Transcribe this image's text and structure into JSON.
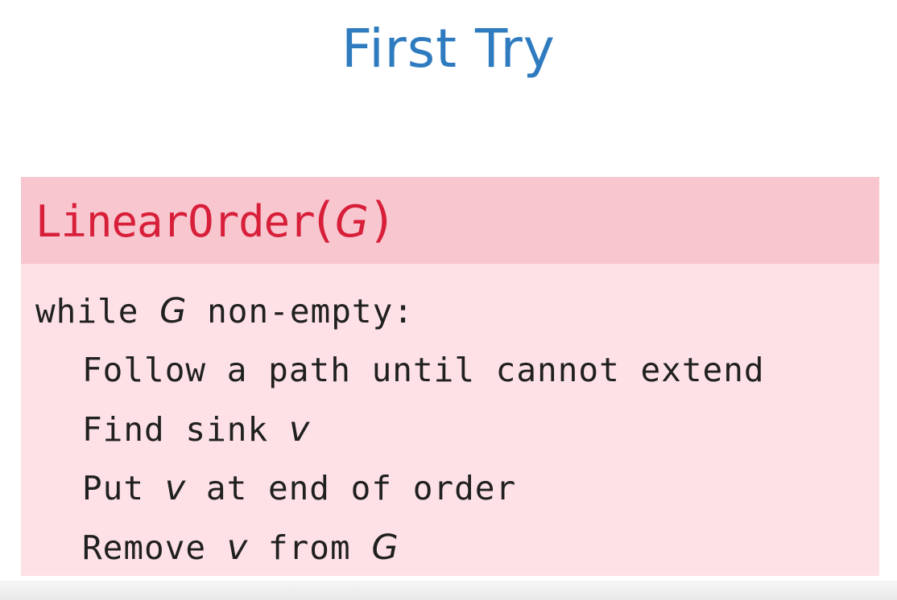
{
  "slide": {
    "title": "First Try"
  },
  "algorithm": {
    "name": "LinearOrder",
    "open_paren": "(",
    "argument": "G",
    "close_paren": ")",
    "lines": [
      {
        "text": "while ",
        "math": "G",
        "rest": " non-empty:"
      },
      {
        "text": "Follow a path until cannot extend"
      },
      {
        "text": "Find sink ",
        "math": "v"
      },
      {
        "text": "Put ",
        "math": "v",
        "rest": " at end of order"
      },
      {
        "text": "Remove ",
        "math": "v",
        "rest": " from ",
        "math2": "G"
      }
    ]
  },
  "colors": {
    "title": "#2f7bbf",
    "header_background": "#f8c6cf",
    "body_background": "#fde1e6",
    "algorithm_name": "#d81f3a",
    "code_text": "#202020"
  }
}
